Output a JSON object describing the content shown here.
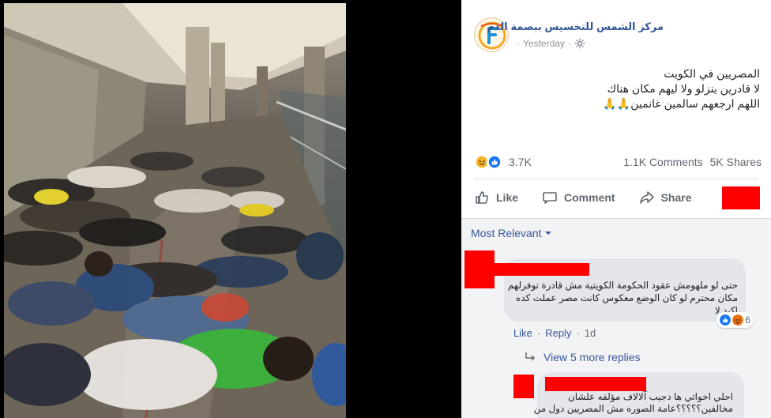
{
  "post": {
    "page_name": "مركز الشمس للتخسيس ببصمة الدم",
    "time": "Yesterday",
    "text_lines": [
      "المصريين في الكويت",
      "لا قادرين ينزلو ولا ليهم مكان هناك",
      "اللهم ارجعهم سالمين غانمين🙏🙏"
    ],
    "reactions_count": "3.7K",
    "comments_count": "1.1K Comments",
    "shares_count": "5K Shares",
    "actions": {
      "like": "Like",
      "comment": "Comment",
      "share": "Share"
    }
  },
  "comments": {
    "sort_label": "Most Relevant",
    "first": {
      "lines": [
        "حتى لو ملهومش عقود الحكومة الكويتية مش قادرة توفرلهم",
        "مكان محترم لو كان الوضع معكوس كانت مصر عملت كده",
        "اكيد لا"
      ],
      "reaction_count": "6",
      "like_label": "Like",
      "reply_label": "Reply",
      "separator": "·",
      "time": "1d"
    },
    "more_replies": "View 5 more replies",
    "second": {
      "lines": [
        "احلي اخواتي ها دجيب آلالاف مؤلفه علشان",
        "مخالفين؟؟؟؟؟عامة الصوره مش المصريين دول من"
      ]
    }
  },
  "colors": {
    "link": "#385898",
    "page_name": "#365899",
    "like_blue": "#1877f2",
    "redaction": "#ff0000",
    "bubble": "#e4e6eb"
  },
  "icons": {
    "settings": "gear-icon",
    "like": "thumbs-up-icon",
    "comment": "speech-bubble-icon",
    "share": "share-arrow-icon",
    "dropdown": "chevron-down-icon",
    "reply_arrow": "reply-arrow-icon",
    "reactions": [
      "sad-icon",
      "like-icon"
    ]
  }
}
